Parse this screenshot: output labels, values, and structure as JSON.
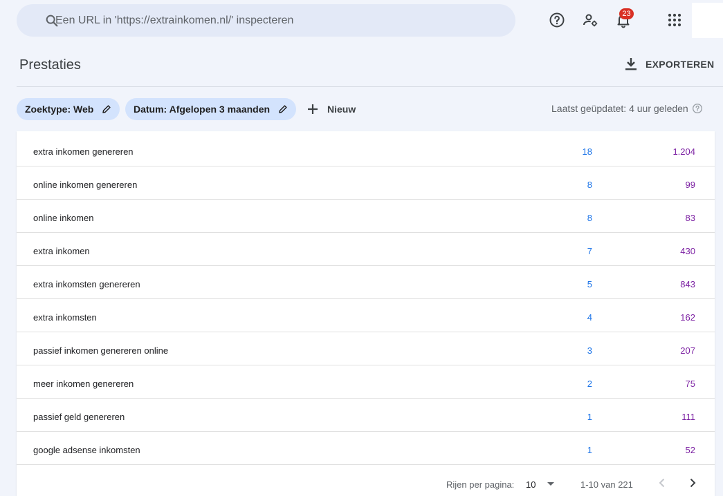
{
  "search": {
    "placeholder": "Een URL in 'https://extrainkomen.nl/' inspecteren"
  },
  "notifications": {
    "count": "23"
  },
  "header": {
    "title": "Prestaties",
    "export_label": "EXPORTEREN"
  },
  "filters": {
    "search_type": "Zoektype: Web",
    "date": "Datum: Afgelopen 3 maanden",
    "new_label": "Nieuw",
    "last_updated": "Laatst geüpdatet: 4 uur geleden"
  },
  "table": {
    "rows": [
      {
        "query": "extra inkomen genereren",
        "clicks": "18",
        "impressions": "1.204"
      },
      {
        "query": "online inkomen genereren",
        "clicks": "8",
        "impressions": "99"
      },
      {
        "query": "online inkomen",
        "clicks": "8",
        "impressions": "83"
      },
      {
        "query": "extra inkomen",
        "clicks": "7",
        "impressions": "430"
      },
      {
        "query": "extra inkomsten genereren",
        "clicks": "5",
        "impressions": "843"
      },
      {
        "query": "extra inkomsten",
        "clicks": "4",
        "impressions": "162"
      },
      {
        "query": "passief inkomen genereren online",
        "clicks": "3",
        "impressions": "207"
      },
      {
        "query": "meer inkomen genereren",
        "clicks": "2",
        "impressions": "75"
      },
      {
        "query": "passief geld genereren",
        "clicks": "1",
        "impressions": "111"
      },
      {
        "query": "google adsense inkomsten",
        "clicks": "1",
        "impressions": "52"
      }
    ]
  },
  "pagination": {
    "rows_per_page_label": "Rijen per pagina:",
    "rows_per_page": "10",
    "range": "1-10 van 221"
  },
  "colors": {
    "clicks": "#1a73e8",
    "impressions": "#7b1fa2",
    "chip": "#d3e3fd",
    "badge": "#d93025"
  }
}
